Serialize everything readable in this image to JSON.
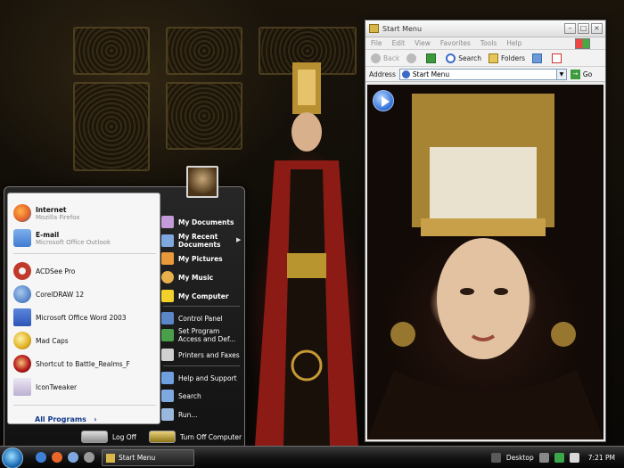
{
  "window": {
    "title": "Start Menu",
    "menu": [
      "File",
      "Edit",
      "View",
      "Favorites",
      "Tools",
      "Help"
    ],
    "toolbar": {
      "back": "Back",
      "search": "Search",
      "folders": "Folders"
    },
    "address_label": "Address",
    "address_value": "Start Menu",
    "go_label": "Go"
  },
  "start_menu": {
    "pinned": [
      {
        "name": "Internet",
        "sub": "Mozilla Firefox",
        "icon": "firefox-icon",
        "color": "#e8662a"
      },
      {
        "name": "E-mail",
        "sub": "Microsoft Office Outlook",
        "icon": "outlook-icon",
        "color": "#3f7bd1"
      }
    ],
    "recent": [
      {
        "name": "ACDSee Pro",
        "icon": "acdsee-icon",
        "color": "#c0392b"
      },
      {
        "name": "CorelDRAW 12",
        "icon": "coreldraw-icon",
        "color": "#2a5fb0"
      },
      {
        "name": "Microsoft Office Word 2003",
        "icon": "word-icon",
        "color": "#2b56b8"
      },
      {
        "name": "Mad Caps",
        "icon": "madcaps-icon",
        "color": "#e0b020"
      },
      {
        "name": "Shortcut to Battle_Realms_F",
        "icon": "battle-realms-icon",
        "color": "#b81c1c"
      },
      {
        "name": "IconTweaker",
        "icon": "icontweaker-icon",
        "color": "#7a2ea8"
      }
    ],
    "all_programs": "All Programs",
    "right": {
      "my_documents": "My Documents",
      "my_recent_documents": "My Recent Documents",
      "my_pictures": "My Pictures",
      "my_music": "My Music",
      "my_computer": "My Computer",
      "control_panel": "Control Panel",
      "set_program_access": "Set Program Access and Def...",
      "printers_faxes": "Printers and Faxes",
      "help_support": "Help and Support",
      "search": "Search",
      "run": "Run..."
    },
    "log_off": "Log Off",
    "turn_off": "Turn Off Computer"
  },
  "taskbar": {
    "task_button": "Start Menu",
    "desktop_label": "Desktop",
    "time": "7:21 PM"
  }
}
